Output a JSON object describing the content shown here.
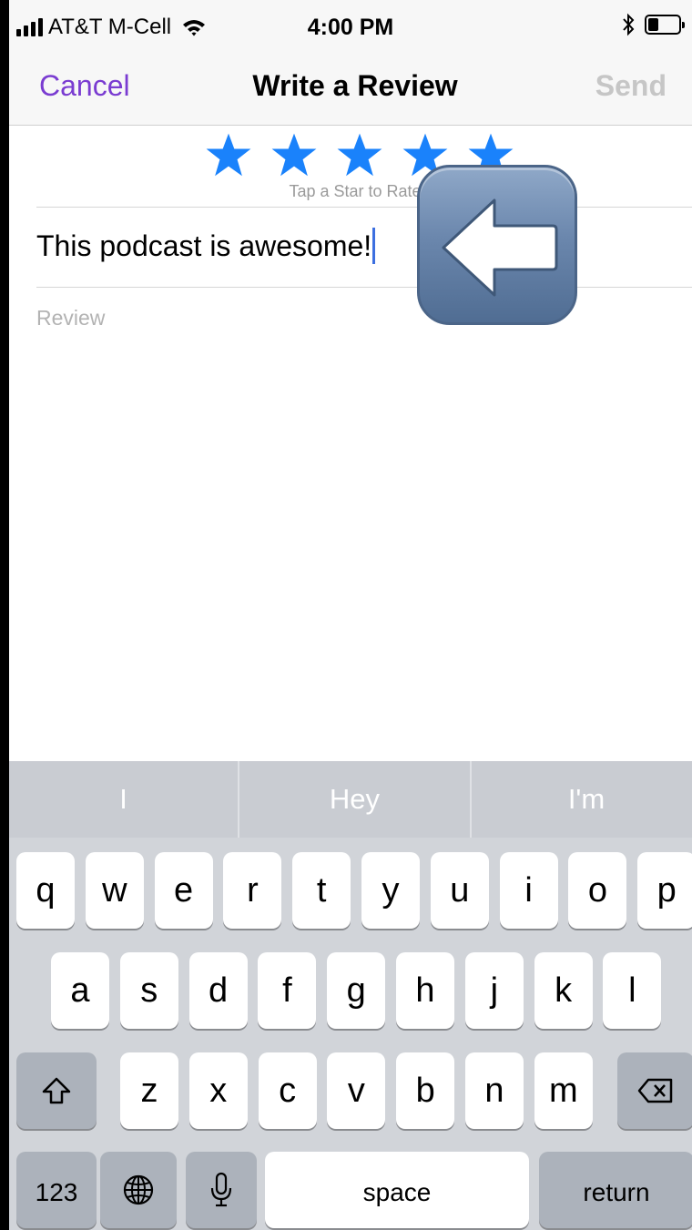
{
  "status_bar": {
    "carrier": "AT&T M-Cell",
    "time": "4:00 PM",
    "icons": [
      "signal-icon",
      "wifi-icon",
      "bluetooth-icon",
      "battery-icon"
    ]
  },
  "nav": {
    "cancel_label": "Cancel",
    "title": "Write a Review",
    "send_label": "Send"
  },
  "rating": {
    "stars_selected": 5,
    "stars_total": 5,
    "hint": "Tap a Star to Rate"
  },
  "form": {
    "title_value": "This podcast is awesome!",
    "review_placeholder": "Review"
  },
  "overlay": {
    "icon": "left-arrow-icon"
  },
  "keyboard": {
    "suggestions": [
      "I",
      "Hey",
      "I'm"
    ],
    "row1": [
      "q",
      "w",
      "e",
      "r",
      "t",
      "y",
      "u",
      "i",
      "o",
      "p"
    ],
    "row2": [
      "a",
      "s",
      "d",
      "f",
      "g",
      "h",
      "j",
      "k",
      "l"
    ],
    "row3": [
      "z",
      "x",
      "c",
      "v",
      "b",
      "n",
      "m"
    ],
    "numbers_label": "123",
    "space_label": "space",
    "return_label": "return"
  },
  "colors": {
    "accent": "#7a3cd1",
    "star": "#1a82fb",
    "send_disabled": "#c6c6c6",
    "caret": "#3c6fe0"
  }
}
